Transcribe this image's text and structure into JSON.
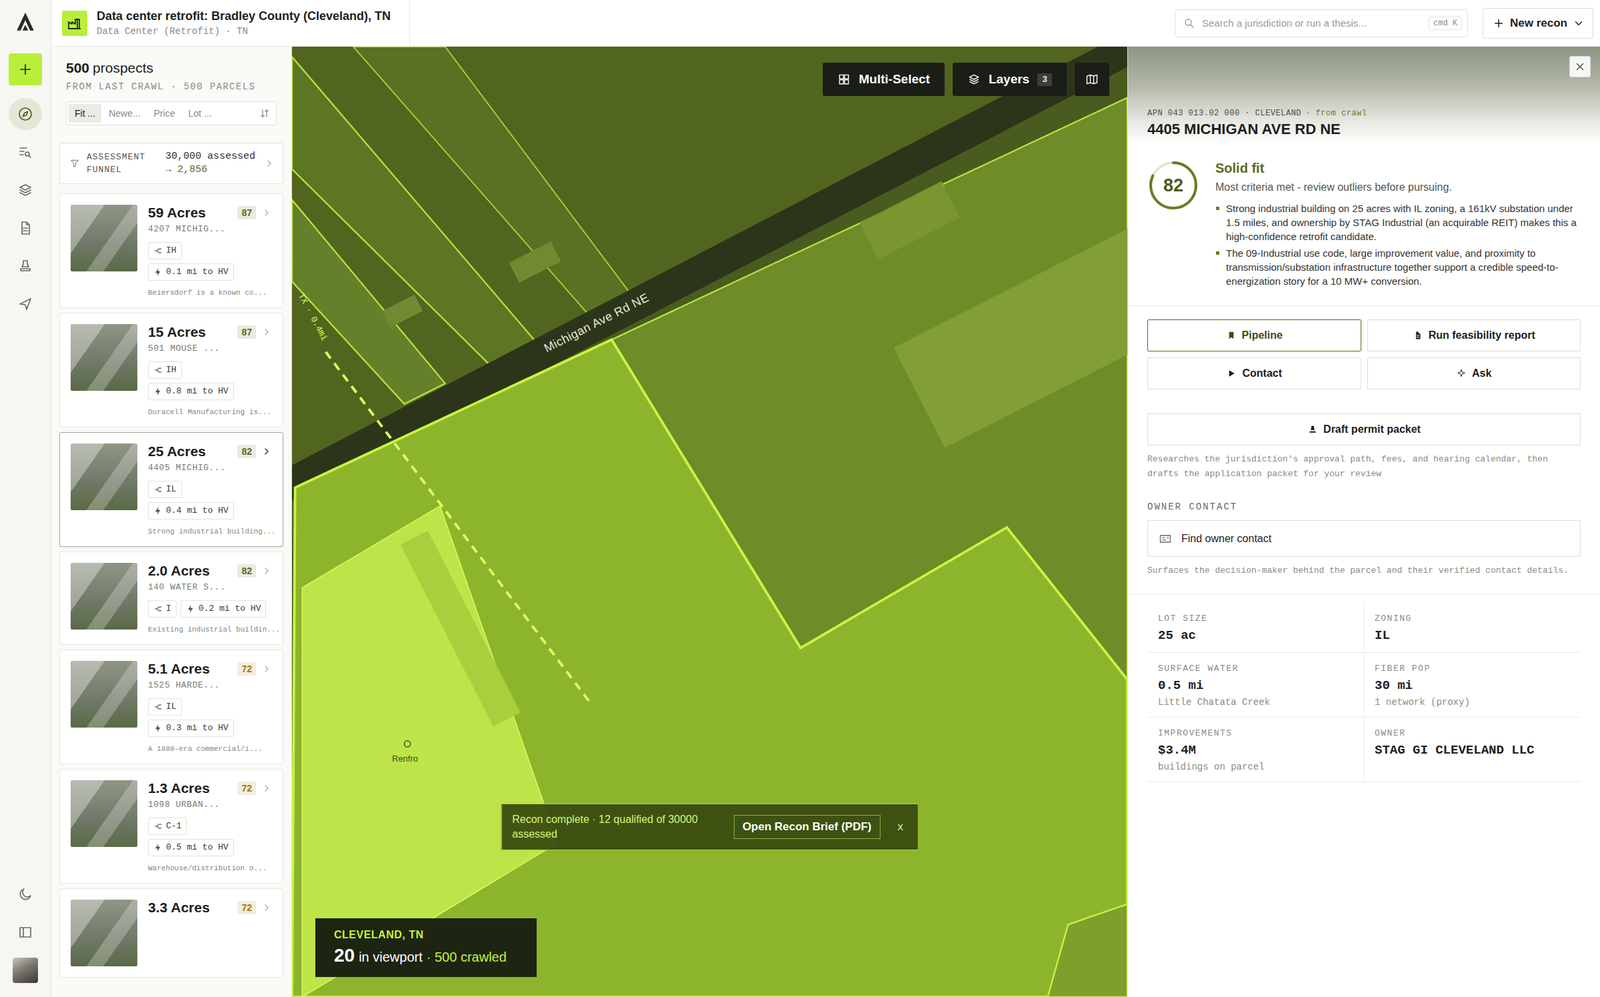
{
  "app": {
    "title": "Data center retrofit: Bradley County (Cleveland), TN",
    "subtitle": "Data Center (Retrofit) · TN"
  },
  "search": {
    "placeholder": "Search a jurisdiction or run a thesis...",
    "shortcut": "cmd K"
  },
  "new_button": {
    "label": "New recon"
  },
  "rail": {
    "top": [
      {
        "kind": "plus",
        "selected": false
      },
      {
        "kind": "compass",
        "selected": true
      },
      {
        "kind": "list-search",
        "selected": false
      },
      {
        "kind": "layers",
        "selected": false
      },
      {
        "kind": "document",
        "selected": false
      },
      {
        "kind": "stamp",
        "selected": false
      },
      {
        "kind": "send",
        "selected": false
      }
    ],
    "bottom": [
      {
        "kind": "moon",
        "selected": false
      },
      {
        "kind": "sidebar",
        "selected": false
      },
      {
        "kind": "avatar",
        "selected": false
      }
    ]
  },
  "prospects": {
    "count": "500",
    "count_label": "prospects",
    "source": "FROM LAST CRAWL · 500 PARCELS",
    "sort_tabs": [
      {
        "label": "Fit ...",
        "selected": true
      },
      {
        "label": "Newe...",
        "selected": false
      },
      {
        "label": "Price",
        "selected": false
      },
      {
        "label": "Lot ...",
        "selected": false
      }
    ],
    "funnel": {
      "label": "ASSESSMENT FUNNEL",
      "assessed": "30,000 assessed",
      "qualified": "→ 2,856"
    },
    "cards": [
      {
        "acres": "59 Acres",
        "score": "87",
        "color": "#5c6a22",
        "address": "4207 MICHIG...",
        "zoning": "IH",
        "power": "0.1 mi to HV",
        "summary": "Beiersdorf is a known co...",
        "selected": false
      },
      {
        "acres": "15 Acres",
        "score": "87",
        "color": "#5c6a22",
        "address": "501 MOUSE ...",
        "zoning": "IH",
        "power": "0.8 mi to HV",
        "summary": "Duracell Manufacturing is...",
        "selected": false
      },
      {
        "acres": "25 Acres",
        "score": "82",
        "color": "#5c6a22",
        "address": "4405 MICHIG...",
        "zoning": "IL",
        "power": "0.4 mi to HV",
        "summary": "Strong industrial building...",
        "selected": true
      },
      {
        "acres": "2.0 Acres",
        "score": "82",
        "color": "#5c6a22",
        "address": "140 WATER S...",
        "zoning": "I",
        "power": "0.2 mi to HV",
        "summary": "Existing industrial buildin...",
        "selected": false
      },
      {
        "acres": "5.1 Acres",
        "score": "72",
        "color": "#a47a0c",
        "address": "1525 HARDE...",
        "zoning": "IL",
        "power": "0.3 mi to HV",
        "summary": "A 1980-era commercial/i...",
        "selected": false
      },
      {
        "acres": "1.3 Acres",
        "score": "72",
        "color": "#a47a0c",
        "address": "1098 URBAN...",
        "zoning": "C-1",
        "power": "0.5 mi to HV",
        "summary": "Warehouse/distribution o...",
        "selected": false
      },
      {
        "acres": "3.3 Acres",
        "score": "72",
        "color": "#a47a0c",
        "selected": false
      }
    ]
  },
  "map": {
    "road_label": "Michigan Ave Rd NE",
    "distance_label": "TX · 0.4mi",
    "place_label": "Renfro",
    "controls": {
      "multi_select": "Multi-Select",
      "layers": "Layers",
      "layers_count": "3"
    },
    "toast": {
      "text": "Recon complete · 12 qualified of 30000 assessed",
      "action": "Open Recon Brief (PDF)",
      "close": "x"
    },
    "viewport": {
      "city": "CLEVELAND, TN",
      "count": "20",
      "count_label": "in viewport",
      "crawled": "· 500 crawled"
    }
  },
  "detail": {
    "apn": "APN 043 013.02 000 · CLEVELAND",
    "source_tag": "· from crawl",
    "address": "4405 MICHIGAN AVE RD NE",
    "score": "82",
    "score_level": 0.82,
    "verdict": "Solid fit",
    "verdict_note": "Most criteria met - review outliers before pursuing.",
    "reasons": [
      "Strong industrial building on 25 acres with IL zoning, a 161kV substation under 1.5 miles, and ownership by STAG Industrial (an acquirable REIT) makes this a high-confidence retrofit candidate.",
      "The 09-Industrial use code, large improvement value, and proximity to transmission/substation infrastructure together support a credible speed-to-energization story for a 10 MW+ conversion."
    ],
    "actions": [
      {
        "label": "Pipeline",
        "kind": "bookmark",
        "primary": true
      },
      {
        "label": "Run feasibility report",
        "kind": "document",
        "primary": false
      },
      {
        "label": "Contact",
        "kind": "play",
        "primary": false
      },
      {
        "label": "Ask",
        "kind": "sparkle",
        "primary": false
      }
    ],
    "permit": {
      "label": "Draft permit packet",
      "note": "Researches the jurisdiction's approval path, fees, and hearing calendar, then drafts the application packet for your review"
    },
    "owner_contact": {
      "heading": "OWNER CONTACT",
      "button": "Find owner contact",
      "note": "Surfaces the decision-maker behind the parcel and their verified contact details."
    },
    "facts": [
      {
        "label": "LOT SIZE",
        "value": "25 ac"
      },
      {
        "label": "ZONING",
        "value": "IL"
      },
      {
        "label": "SURFACE WATER",
        "value": "0.5 mi",
        "sub": "Little Chatata Creek"
      },
      {
        "label": "FIBER POP",
        "value": "30 mi",
        "sub": "1 network (proxy)"
      },
      {
        "label": "IMPROVEMENTS",
        "value": "$3.4M",
        "sub": "buildings on parcel"
      },
      {
        "label": "OWNER",
        "value": "STAG GI CLEVELAND LLC"
      }
    ]
  }
}
